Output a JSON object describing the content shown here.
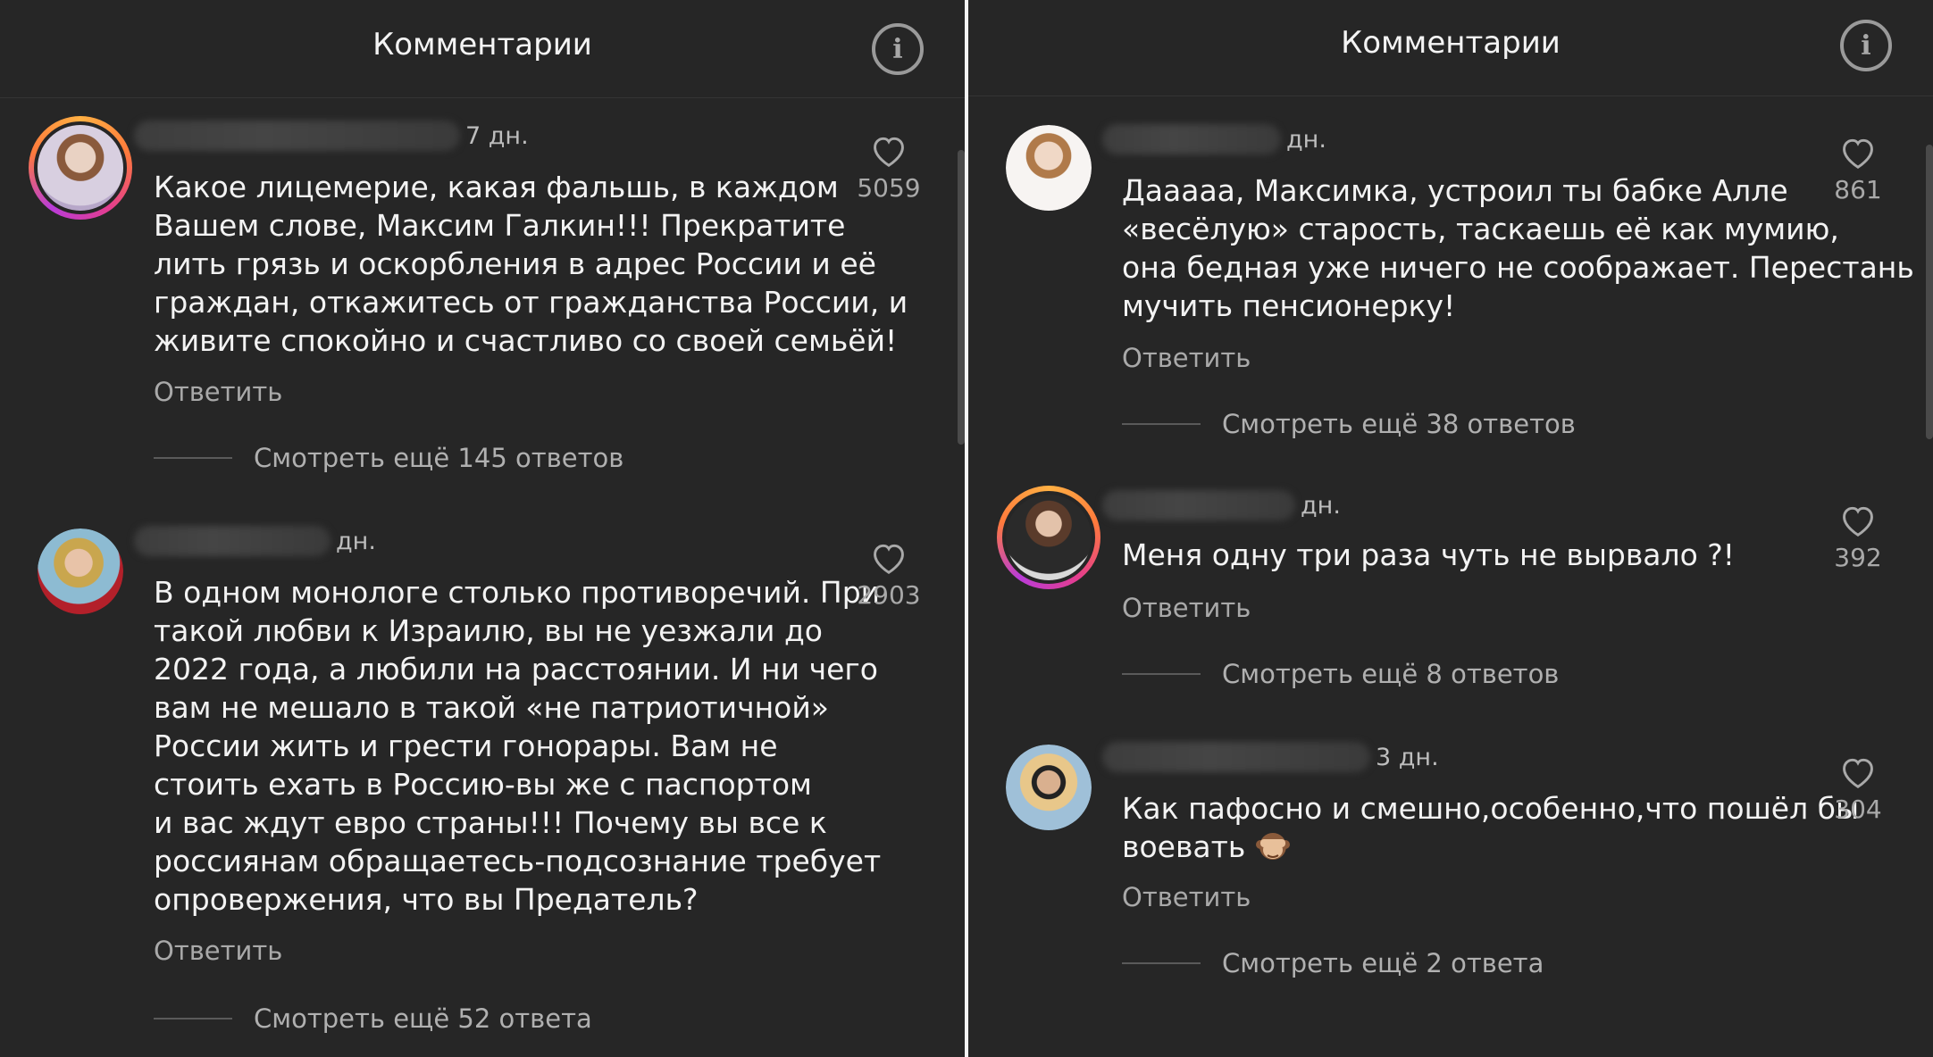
{
  "panels": [
    {
      "header": {
        "title": "Комментарии"
      },
      "comments": [
        {
          "time": "7 дн.",
          "text": "Какое лицемерие, какая фальшь, в каждом\nВашем слове, Максим Галкин!!! Прекратите\nлить грязь и оскорбления в адрес России и её\nграждан, откажитесь от гражданства России, и\nживите спокойно и счастливо со своей семьёй!",
          "reply": "Ответить",
          "more": "Смотреть ещё 145 ответов",
          "likes": "5059"
        },
        {
          "time": "дн.",
          "text": "В одном монологе столько противоречий.  При\nтакой любви к Израилю, вы не уезжали до\n2022 года, а любили на расстоянии. И ни чего\nвам не мешало в такой «не патриотичной»\nРоссии жить и грести гонорары. Вам не\nстоить ехать в Россию-вы же с паспортом\nи вас ждут евро страны!!! Почему вы все к\nроссиянам обращаетесь-подсознание требует\nопровержения, что вы Предатель?",
          "reply": "Ответить",
          "more": "Смотреть ещё 52 ответа",
          "likes": "2903"
        }
      ]
    },
    {
      "header": {
        "title": "Комментарии"
      },
      "comments": [
        {
          "time": "дн.",
          "text": "Дааааа, Максимка, устроил ты бабке Алле\n«весёлую» старость, таскаешь её как мумию,\nона бедная уже ничего не соображает. Перестань\nмучить пенсионерку!",
          "reply": "Ответить",
          "more": "Смотреть ещё 38 ответов",
          "likes": "861"
        },
        {
          "time": "дн.",
          "text": "Меня одну три раза чуть не вырвало ?!",
          "reply": "Ответить",
          "more": "Смотреть ещё 8 ответов",
          "likes": "392"
        },
        {
          "time": "3 дн.",
          "text": "Как пафосно и смешно,особенно,что пошёл бы\nвоевать",
          "reply": "Ответить",
          "more": "Смотреть ещё 2 ответа",
          "likes": "304"
        }
      ]
    }
  ],
  "icons": {
    "info": "info-icon",
    "like": "heart-icon",
    "emoji": "see-no-evil-monkey-icon"
  },
  "colors": {
    "background": "#262626",
    "story_ring": [
      "#ffb043",
      "#e43d8e",
      "#b93cd8"
    ]
  }
}
